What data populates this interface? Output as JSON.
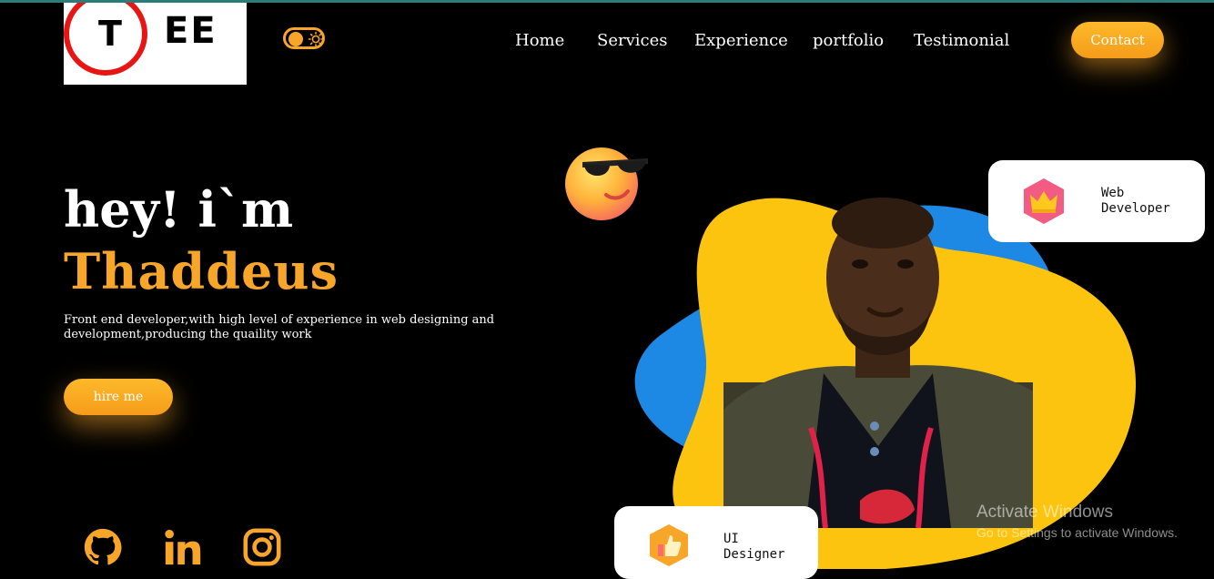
{
  "logo": {
    "letter_t": "T",
    "letters_ee": "EE"
  },
  "theme_toggle": {
    "icon": "sun-icon"
  },
  "nav": {
    "items": [
      "Home",
      "Services",
      "Experience",
      "portfolio",
      "Testimonial"
    ],
    "contact_label": "Contact"
  },
  "hero": {
    "greeting": "hey! i`m",
    "name": "Thaddeus",
    "description": "Front end developer,with high level of experience in web designing and development,producing the quaility work",
    "hire_label": "hire me"
  },
  "social": {
    "icons": [
      "github-icon",
      "linkedin-icon",
      "instagram-icon"
    ]
  },
  "cards": {
    "web": {
      "label": "Web\nDeveloper",
      "icon": "crown-icon"
    },
    "ui": {
      "label": "UI\nDesigner",
      "icon": "thumbs-up-icon"
    }
  },
  "watermark": {
    "title": "Activate Windows",
    "subtitle": "Go to Settings to activate Windows."
  },
  "colors": {
    "accent": "#f7a629",
    "blob_yellow": "#fdc40f",
    "blob_blue": "#1e88e5",
    "background": "#000000"
  }
}
